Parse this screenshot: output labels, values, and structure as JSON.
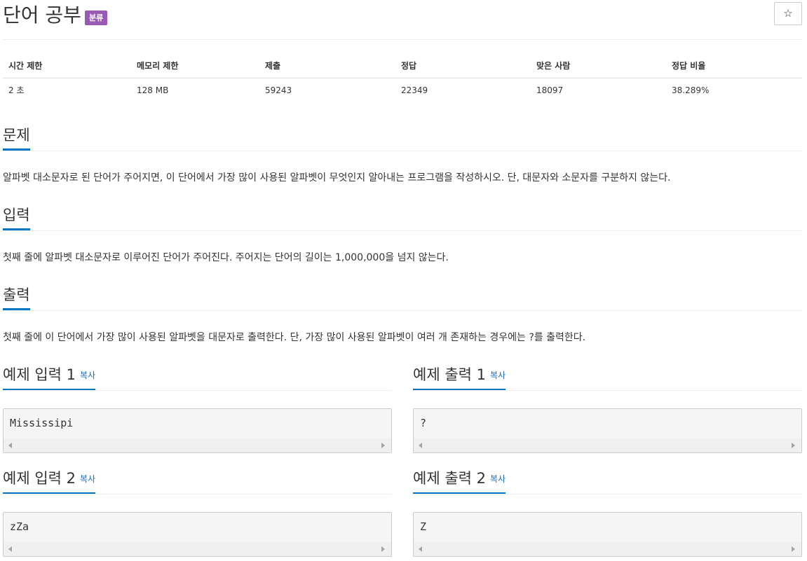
{
  "problem": {
    "title": "단어 공부",
    "badge": "분류",
    "star": "☆"
  },
  "info_table": {
    "headers": [
      "시간 제한",
      "메모리 제한",
      "제출",
      "정답",
      "맞은 사람",
      "정답 비율"
    ],
    "values": [
      "2 초",
      "128 MB",
      "59243",
      "22349",
      "18097",
      "38.289%"
    ]
  },
  "sections": {
    "description": {
      "heading": "문제",
      "text": "알파벳 대소문자로 된 단어가 주어지면, 이 단어에서 가장 많이 사용된 알파벳이 무엇인지 알아내는 프로그램을 작성하시오. 단, 대문자와 소문자를 구분하지 않는다."
    },
    "input": {
      "heading": "입력",
      "text": "첫째 줄에 알파벳 대소문자로 이루어진 단어가 주어진다. 주어지는 단어의 길이는 1,000,000을 넘지 않는다."
    },
    "output": {
      "heading": "출력",
      "text": "첫째 줄에 이 단어에서 가장 많이 사용된 알파벳을 대문자로 출력한다. 단, 가장 많이 사용된 알파벳이 여러 개 존재하는 경우에는 ?를 출력한다."
    }
  },
  "samples": {
    "copy_label": "복사",
    "input1": {
      "heading": "예제 입력 1",
      "content": "Mississipi"
    },
    "output1": {
      "heading": "예제 출력 1",
      "content": "?"
    },
    "input2": {
      "heading": "예제 입력 2",
      "content": "zZa"
    },
    "output2": {
      "heading": "예제 출력 2",
      "content": "Z"
    }
  },
  "colors": {
    "accent": "#0076c0",
    "badge": "#9b59b6",
    "link": "#1a6bb5"
  }
}
